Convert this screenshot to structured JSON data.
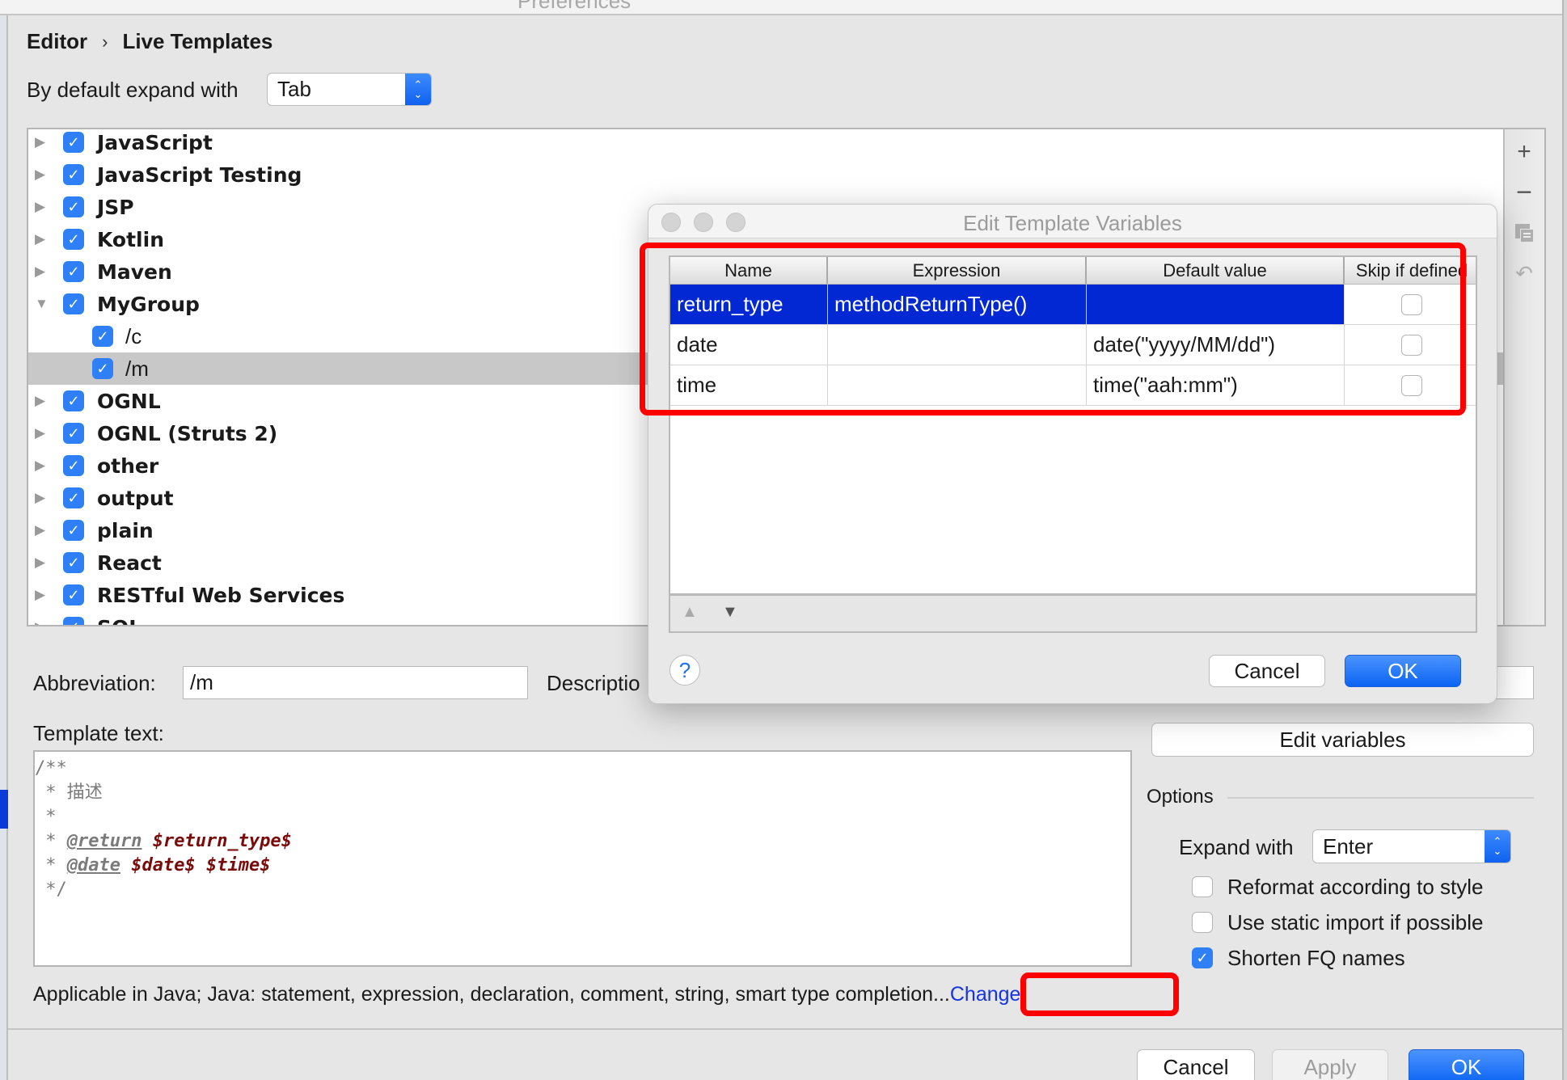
{
  "window": {
    "title": "Preferences"
  },
  "breadcrumb": {
    "parent": "Editor",
    "separator": "›",
    "current": "Live Templates"
  },
  "expand_default": {
    "label": "By default expand with",
    "value": "Tab"
  },
  "tree": {
    "items": [
      {
        "label": "JavaScript",
        "checked": true,
        "expanded": false,
        "level": 0
      },
      {
        "label": "JavaScript Testing",
        "checked": true,
        "expanded": false,
        "level": 0
      },
      {
        "label": "JSP",
        "checked": true,
        "expanded": false,
        "level": 0
      },
      {
        "label": "Kotlin",
        "checked": true,
        "expanded": false,
        "level": 0
      },
      {
        "label": "Maven",
        "checked": true,
        "expanded": false,
        "level": 0
      },
      {
        "label": "MyGroup",
        "checked": true,
        "expanded": true,
        "level": 0
      },
      {
        "label": "/c",
        "checked": true,
        "level": 1
      },
      {
        "label": "/m",
        "checked": true,
        "level": 1,
        "selected": true
      },
      {
        "label": "OGNL",
        "checked": true,
        "expanded": false,
        "level": 0
      },
      {
        "label": "OGNL (Struts 2)",
        "checked": true,
        "expanded": false,
        "level": 0
      },
      {
        "label": "other",
        "checked": true,
        "expanded": false,
        "level": 0
      },
      {
        "label": "output",
        "checked": true,
        "expanded": false,
        "level": 0
      },
      {
        "label": "plain",
        "checked": true,
        "expanded": false,
        "level": 0
      },
      {
        "label": "React",
        "checked": true,
        "expanded": false,
        "level": 0
      },
      {
        "label": "RESTful Web Services",
        "checked": true,
        "expanded": false,
        "level": 0
      },
      {
        "label": "SQL",
        "checked": true,
        "expanded": false,
        "level": 0
      }
    ],
    "toolbar": {
      "add": "+",
      "remove": "−",
      "copy": "copy-icon",
      "restore": "↶"
    }
  },
  "form": {
    "abbreviation_label": "Abbreviation:",
    "abbreviation_value": "/m",
    "description_label": "Descriptio",
    "template_text_label": "Template text:",
    "template_lines": [
      {
        "parts": [
          {
            "t": "/**",
            "k": "c"
          }
        ]
      },
      {
        "parts": [
          {
            "t": " * 描述",
            "k": "c"
          }
        ]
      },
      {
        "parts": [
          {
            "t": " *",
            "k": "c"
          }
        ]
      },
      {
        "parts": [
          {
            "t": " * ",
            "k": "c"
          },
          {
            "t": "@return",
            "k": "tag"
          },
          {
            "t": " ",
            "k": "c"
          },
          {
            "t": "$return_type$",
            "k": "var"
          }
        ]
      },
      {
        "parts": [
          {
            "t": " * ",
            "k": "c"
          },
          {
            "t": "@date",
            "k": "tag"
          },
          {
            "t": " ",
            "k": "c"
          },
          {
            "t": "$date$",
            "k": "var"
          },
          {
            "t": " ",
            "k": "c"
          },
          {
            "t": "$time$",
            "k": "var"
          }
        ]
      },
      {
        "parts": [
          {
            "t": " */",
            "k": "c"
          }
        ]
      }
    ],
    "edit_variables_label": "Edit variables",
    "applicable_text": "Applicable in Java; Java: statement, expression, declaration, comment, string, smart type completion...",
    "change_link": "Change"
  },
  "options": {
    "title": "Options",
    "expand_with_label": "Expand with",
    "expand_with_value": "Enter",
    "checkboxes": [
      {
        "label": "Reformat according to style",
        "checked": false
      },
      {
        "label": "Use static import if possible",
        "checked": false
      },
      {
        "label": "Shorten FQ names",
        "checked": true
      }
    ]
  },
  "footer": {
    "cancel": "Cancel",
    "apply": "Apply",
    "ok": "OK"
  },
  "dialog": {
    "title": "Edit Template Variables",
    "columns": [
      "Name",
      "Expression",
      "Default value",
      "Skip if defined"
    ],
    "rows": [
      {
        "name": "return_type",
        "expression": "methodReturnType()",
        "default": "",
        "skip": false,
        "selected": true
      },
      {
        "name": "date",
        "expression": "",
        "default": "date(\"yyyy/MM/dd\")",
        "skip": false
      },
      {
        "name": "time",
        "expression": "",
        "default": "time(\"aah:mm\")",
        "skip": false
      }
    ],
    "move_up": "▲",
    "move_down": "▼",
    "help": "?",
    "cancel": "Cancel",
    "ok": "OK"
  },
  "colors": {
    "accent": "#2f80f6",
    "selection": "#0228d4",
    "highlight_box": "#ff0000",
    "link": "#1432e6",
    "template_variable": "#7a0b0b"
  }
}
